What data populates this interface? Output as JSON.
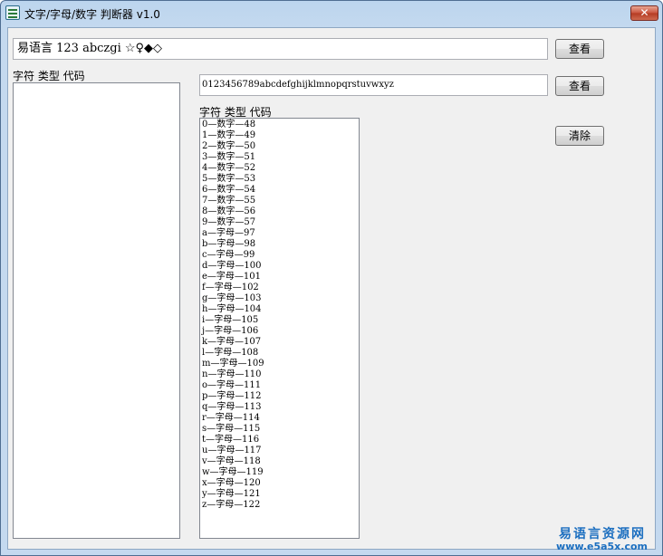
{
  "window": {
    "title": "文字/字母/数字 判断器 v1.0",
    "close_glyph": "✕"
  },
  "input1": {
    "value": "易语言 123 abczgi ☆♀◆◇"
  },
  "button_view1": {
    "label": "查看"
  },
  "left_list": {
    "header": "字符 类型 代码",
    "items": []
  },
  "input2": {
    "value": "0123456789abcdefghijklmnopqrstuvwxyz"
  },
  "button_view2": {
    "label": "查看"
  },
  "right_list": {
    "header": "字符 类型 代码",
    "items": [
      "0—数字—48",
      "1—数字—49",
      "2—数字—50",
      "3—数字—51",
      "4—数字—52",
      "5—数字—53",
      "6—数字—54",
      "7—数字—55",
      "8—数字—56",
      "9—数字—57",
      "a—字母—97",
      "b—字母—98",
      "c—字母—99",
      "d—字母—100",
      "e—字母—101",
      "f—字母—102",
      "g—字母—103",
      "h—字母—104",
      "i—字母—105",
      "j—字母—106",
      "k—字母—107",
      "l—字母—108",
      "m—字母—109",
      "n—字母—110",
      "o—字母—111",
      "p—字母—112",
      "q—字母—113",
      "r—字母—114",
      "s—字母—115",
      "t—字母—116",
      "u—字母—117",
      "v—字母—118",
      "w—字母—119",
      "x—字母—120",
      "y—字母—121",
      "z—字母—122"
    ]
  },
  "button_clear": {
    "label": "清除"
  },
  "watermark": {
    "line1": "易语言资源网",
    "line2": "www.e5a5x.com"
  },
  "colors": {
    "accent": "#1c6fc0",
    "close": "#c9533c"
  }
}
